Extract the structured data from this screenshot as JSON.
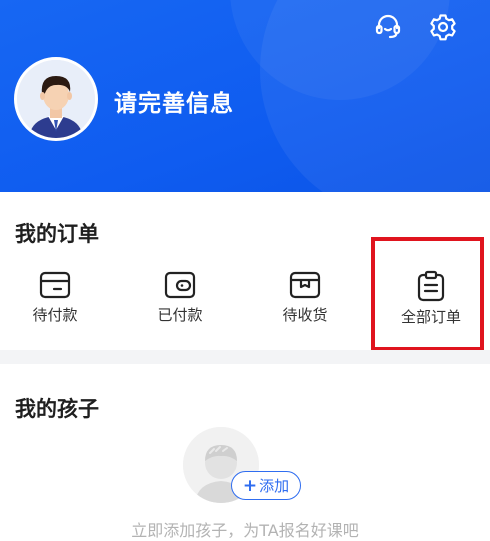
{
  "profile": {
    "name": "请完善信息"
  },
  "header": {
    "support_icon": "headset-icon",
    "settings_icon": "gear-icon",
    "accent_color": "#1464f0"
  },
  "orders": {
    "title": "我的订单",
    "items": [
      {
        "label": "待付款",
        "icon": "card-icon"
      },
      {
        "label": "已付款",
        "icon": "wallet-icon"
      },
      {
        "label": "待收货",
        "icon": "box-icon"
      },
      {
        "label": "全部订单",
        "icon": "clipboard-icon"
      }
    ],
    "highlight_color": "#e0141e"
  },
  "kids": {
    "title": "我的孩子",
    "add_label": "添加",
    "hint": "立即添加孩子，为TA报名好课吧"
  }
}
